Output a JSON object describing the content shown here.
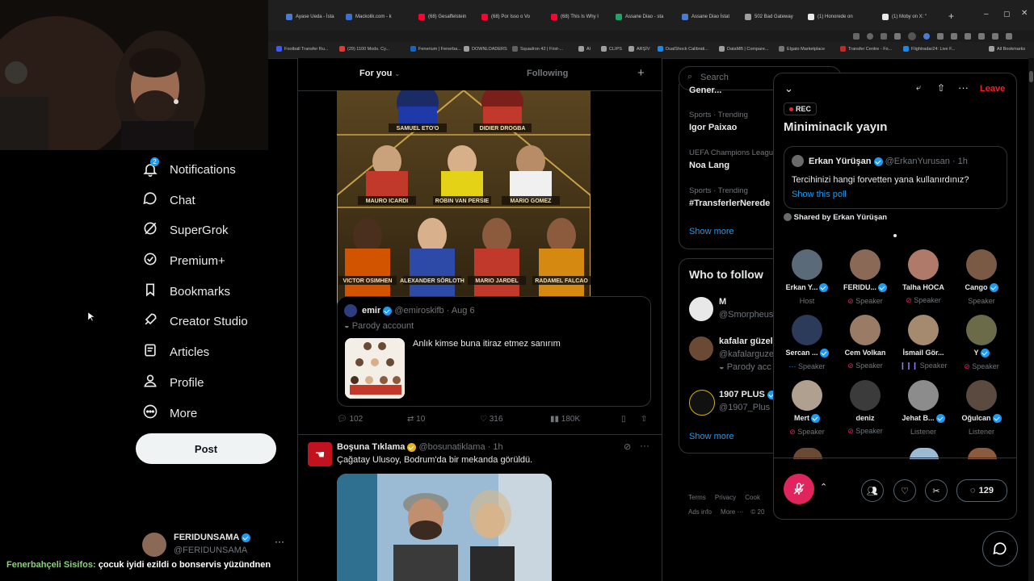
{
  "browser": {
    "tabs": [
      "Ayase Ueda - İsta",
      "Mackolik.com - k",
      "(68) Gesaffelstein",
      "(68) Por Isso o Vo",
      "(68) This Is Why I",
      "Assane Diao - sta",
      "Assane Diao İstat",
      "502 Bad Gateway",
      "(1) Honorede on",
      "(1) Moby on X: \""
    ],
    "tab_colors": [
      "#4a7bd1",
      "#3d6ecf",
      "#ff0033",
      "#ff0033",
      "#ff0033",
      "#21a366",
      "#4a7bd1",
      "#9e9e9e",
      "#e7e9ea",
      "#e7e9ea"
    ],
    "bookmarks": [
      "Football Transfer Ru...",
      "(29) 1100 Mods. Cy...",
      "Fenerium | Fenerba...",
      "DOWNLOADERS",
      "Squadron 42 | First-...",
      "AI",
      "CLIPS",
      "ARŞİV",
      "DualShock Calibrati...",
      "DataMB | Compare...",
      "Elgato Marketplace",
      "Transfer Centre - Fo...",
      "Flightradar24: Live F...",
      "All Bookmarks"
    ]
  },
  "nav": {
    "items": [
      "Notifications",
      "Chat",
      "SuperGrok",
      "Premium+",
      "Bookmarks",
      "Creator Studio",
      "Articles",
      "Profile",
      "More"
    ],
    "notification_count": "2",
    "post_label": "Post",
    "account_name": "FERIDUNSAMA",
    "account_handle": "@FERIDUNSAMA"
  },
  "feed": {
    "tabs": {
      "for_you": "For you",
      "following": "Following"
    },
    "collage_labels": [
      "SAMUEL ETO'O",
      "DIDIER DROGBA",
      "MAURO ICARDI",
      "ROBIN VAN PERSIE",
      "MARIO GOMEZ",
      "VICTOR OSIMHEN",
      "ALEXANDER SÖRLOTH",
      "MARIO JARDEL",
      "RADAMEL FALCAO"
    ],
    "quote": {
      "name": "emir",
      "handle": "@emiroskifb",
      "date": "· Aug 6",
      "label": "Parody account",
      "text": "Anlık kimse buna itiraz etmez sanırım"
    },
    "actions": {
      "replies": "102",
      "reposts": "10",
      "likes": "316",
      "views": "180K"
    },
    "tweet2": {
      "name": "Boşuna Tıklama",
      "handle": "@bosunatiklama",
      "time": "· 1h",
      "text": "Çağatay Ulusoy, Bodrum'da bir mekanda görüldü."
    }
  },
  "right": {
    "search_placeholder": "Search",
    "top_partial": "Gener...",
    "trends": [
      {
        "context": "Sports · Trending",
        "name": "Igor Paixao"
      },
      {
        "context": "UEFA Champions League",
        "name": "Noa Lang"
      },
      {
        "context": "Sports · Trending",
        "name": "#TransferlerNerede"
      }
    ],
    "show_more": "Show more",
    "who_to_follow": "Who to follow",
    "follow": [
      {
        "name": "M",
        "handle": "@Smorpheus"
      },
      {
        "name": "kafalar güzel",
        "handle": "@kafalarguze",
        "note": "Parody acc"
      },
      {
        "name": "1907 PLUS",
        "handle": "@1907_Plus"
      }
    ],
    "show_more_2": "Show more",
    "footer": [
      "Terms",
      "Privacy",
      "Cook",
      "Ads info",
      "More ···",
      "© 20"
    ]
  },
  "space": {
    "leave": "Leave",
    "rec": "REC",
    "title": "Miniminacık yayın",
    "pinned": {
      "name": "Erkan Yürüşan",
      "handle": "@ErkanYurusan",
      "time": "· 1h",
      "text": "Tercihinizi hangi forvetten yana kullanırdınız?",
      "show_poll": "Show this poll"
    },
    "shared_by": "Shared by Erkan Yürüşan",
    "participants": [
      {
        "name": "Erkan Y...",
        "role": "Host",
        "verified": true,
        "mic": "none"
      },
      {
        "name": "FERIDU...",
        "role": "Speaker",
        "verified": true,
        "mic": "muted"
      },
      {
        "name": "Talha HOCA",
        "role": "Speaker",
        "verified": false,
        "mic": "muted"
      },
      {
        "name": "Cango",
        "role": "Speaker",
        "verified": true,
        "mic": "none"
      },
      {
        "name": "Sercan ...",
        "role": "Speaker",
        "verified": true,
        "mic": "dots"
      },
      {
        "name": "Cem Volkan",
        "role": "Speaker",
        "verified": false,
        "mic": "muted"
      },
      {
        "name": "İsmail Gör...",
        "role": "Speaker",
        "verified": false,
        "mic": "talking"
      },
      {
        "name": "Y",
        "role": "Speaker",
        "verified": true,
        "mic": "muted"
      },
      {
        "name": "Mert",
        "role": "Speaker",
        "verified": true,
        "mic": "muted"
      },
      {
        "name": "deniz",
        "role": "Speaker",
        "verified": false,
        "mic": "muted"
      },
      {
        "name": "Jehat B...",
        "role": "Listener",
        "verified": true,
        "mic": "none"
      },
      {
        "name": "Oğulcan",
        "role": "Listener",
        "verified": true,
        "mic": "none"
      }
    ],
    "comments_count": "129"
  },
  "ticker": {
    "name": "Fenerbahçeli Sisifos:",
    "text": "çocuk iyidi ezildi o bonservis yüzündnen"
  },
  "colors": {
    "accent": "#1d9bf0",
    "leave": "#f4212e",
    "mic_button": "#e0245e",
    "ticker_name": "#8bd17c"
  }
}
